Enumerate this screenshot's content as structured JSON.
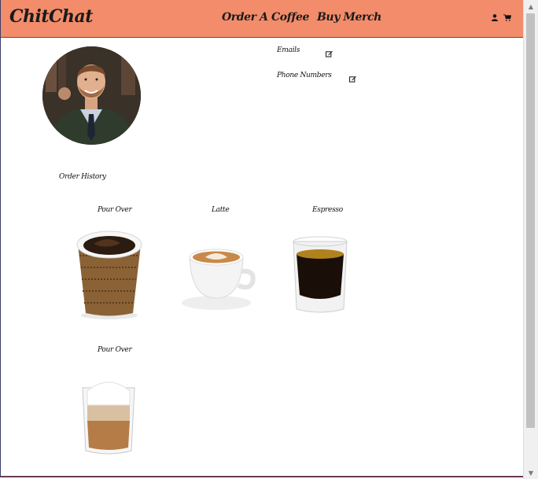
{
  "navbar": {
    "brand": "ChitChat",
    "links": [
      "Order A Coffee",
      "Buy Merch"
    ],
    "icons": [
      "user-icon",
      "cart-icon"
    ],
    "background_color": "#f28c6a"
  },
  "profile": {
    "avatar_alt": "profile photo",
    "fields": [
      {
        "label": "Emails",
        "action_icon": "edit-icon"
      },
      {
        "label": "Phone Numbers",
        "action_icon": "edit-icon"
      }
    ]
  },
  "order_history": {
    "title": "Order History",
    "items": [
      {
        "name": "Pour Over",
        "image": "paper-cup-coffee"
      },
      {
        "name": "Latte",
        "image": "latte-cup"
      },
      {
        "name": "Espresso",
        "image": "espresso-glass"
      },
      {
        "name": "Pour Over",
        "image": "layered-glass-coffee"
      }
    ]
  }
}
